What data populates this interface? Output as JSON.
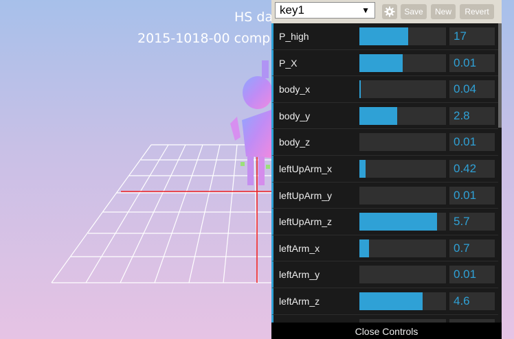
{
  "scene": {
    "title_line1": "HS da",
    "title_line2": "2015-1018-00 comp"
  },
  "controls": {
    "preset": "key1",
    "settings_icon": "gear-icon",
    "save_label": "Save",
    "new_label": "New",
    "revert_label": "Revert",
    "close_label": "Close Controls",
    "accent_color": "#2fa1d6",
    "params": [
      {
        "label": "P_high",
        "value": "17",
        "fill": 0.56
      },
      {
        "label": "P_X",
        "value": "0.01",
        "fill": 0.5
      },
      {
        "label": "body_x",
        "value": "0.04",
        "fill": 0.01
      },
      {
        "label": "body_y",
        "value": "2.8",
        "fill": 0.44
      },
      {
        "label": "body_z",
        "value": "0.01",
        "fill": 0.0
      },
      {
        "label": "leftUpArm_x",
        "value": "0.42",
        "fill": 0.07
      },
      {
        "label": "leftUpArm_y",
        "value": "0.01",
        "fill": 0.0
      },
      {
        "label": "leftUpArm_z",
        "value": "5.7",
        "fill": 0.9
      },
      {
        "label": "leftArm_x",
        "value": "0.7",
        "fill": 0.11
      },
      {
        "label": "leftArm_y",
        "value": "0.01",
        "fill": 0.0
      },
      {
        "label": "leftArm_z",
        "value": "4.6",
        "fill": 0.73
      },
      {
        "label": "",
        "value": "",
        "fill": 0.0
      }
    ]
  }
}
